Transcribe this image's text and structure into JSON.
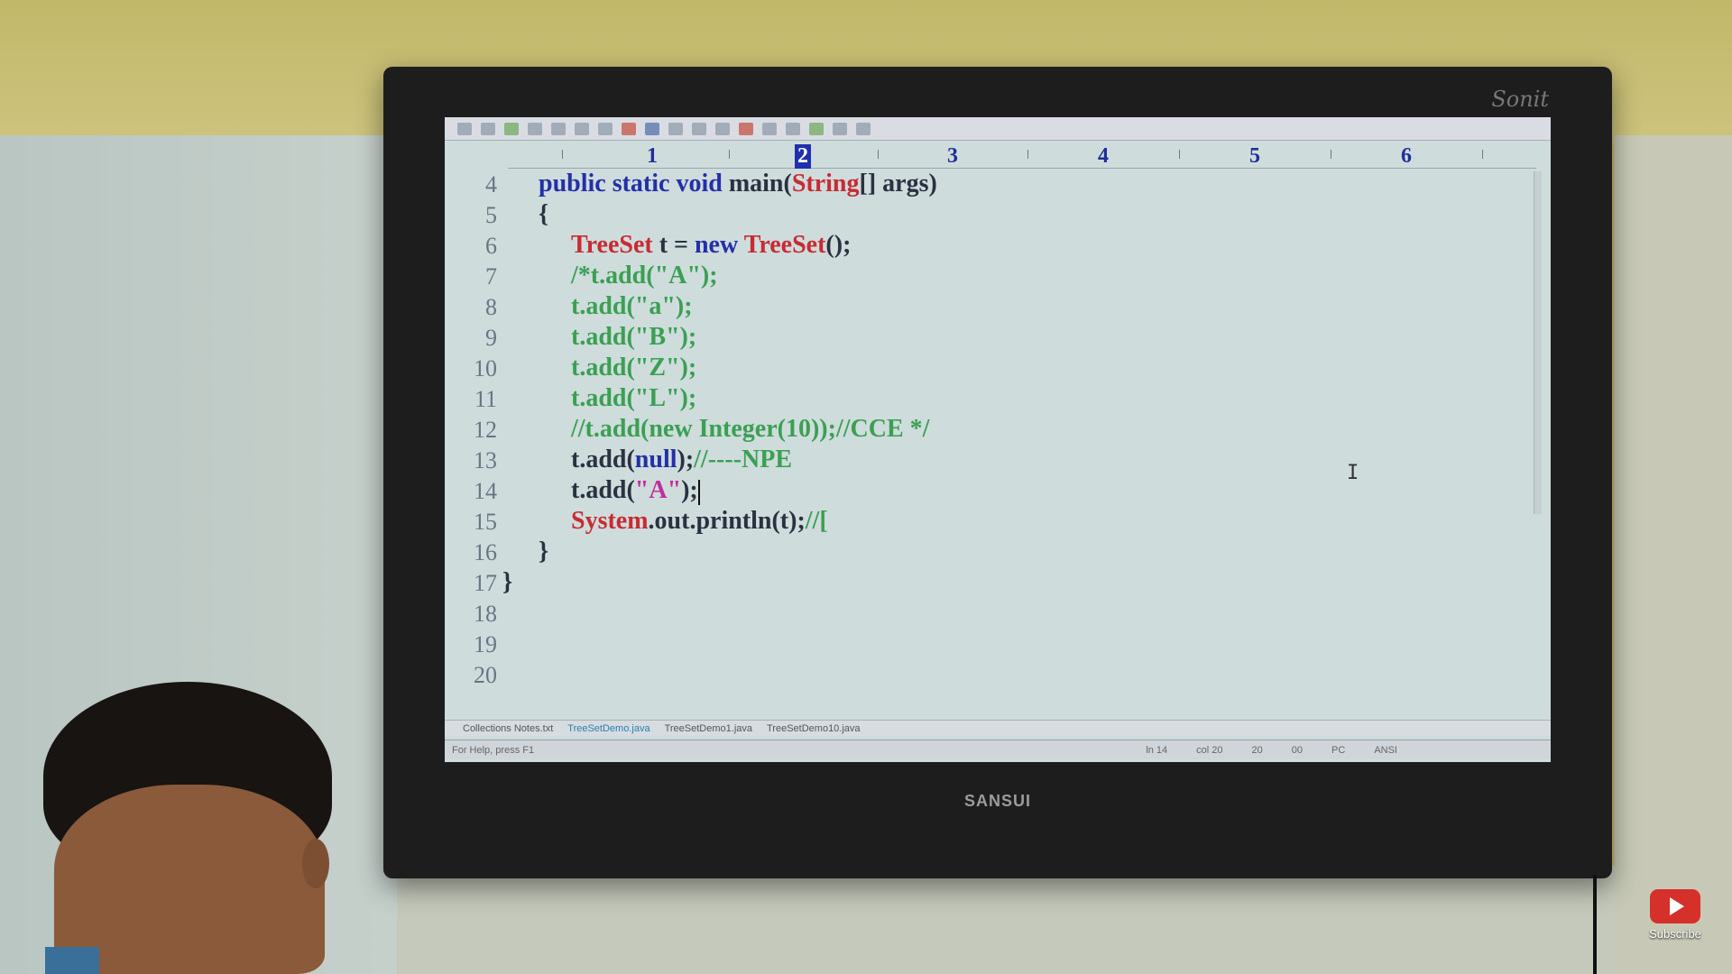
{
  "tv": {
    "brand": "SANSUI",
    "top_logo": "Sonit"
  },
  "editor": {
    "ruler": {
      "numbers": [
        "1",
        "2",
        "3",
        "4",
        "5",
        "6"
      ],
      "active": "2"
    },
    "line_numbers": [
      "4",
      "5",
      "6",
      "7",
      "8",
      "9",
      "10",
      "11",
      "12",
      "13",
      "14",
      "15",
      "16",
      "17",
      "18",
      "19",
      "20"
    ],
    "code": {
      "l4_a": "public static void ",
      "l4_b": "main(",
      "l4_c": "String",
      "l4_d": "[] args)",
      "l5": "{",
      "l6_a": "TreeSet",
      "l6_b": " t = ",
      "l6_c": "new",
      "l6_d": " ",
      "l6_e": "TreeSet",
      "l6_f": "();",
      "l7": "/*t.add(\"A\");",
      "l8": "t.add(\"a\");",
      "l9": "t.add(\"B\");",
      "l10": "t.add(\"Z\");",
      "l11": "t.add(\"L\");",
      "l12": "//t.add(new Integer(10));//CCE */",
      "l13_a": "t.add(",
      "l13_b": "null",
      "l13_c": ");",
      "l13_d": "//----NPE",
      "l14_a": "t.add(",
      "l14_b": "\"A\"",
      "l14_c": ");",
      "l15_a": "System",
      "l15_b": ".out.println(t);",
      "l15_c": "//[",
      "l16": "}",
      "l17": "}"
    },
    "tabs": [
      "Collections Notes.txt",
      "TreeSetDemo.java",
      "TreeSetDemo1.java",
      "TreeSetDemo10.java"
    ],
    "status": {
      "help": "For Help, press F1",
      "ln": "ln 14",
      "col": "col 20",
      "a": "20",
      "b": "00",
      "mode": "PC",
      "enc": "ANSI"
    }
  },
  "overlay": {
    "subscribe": "Subscribe"
  }
}
